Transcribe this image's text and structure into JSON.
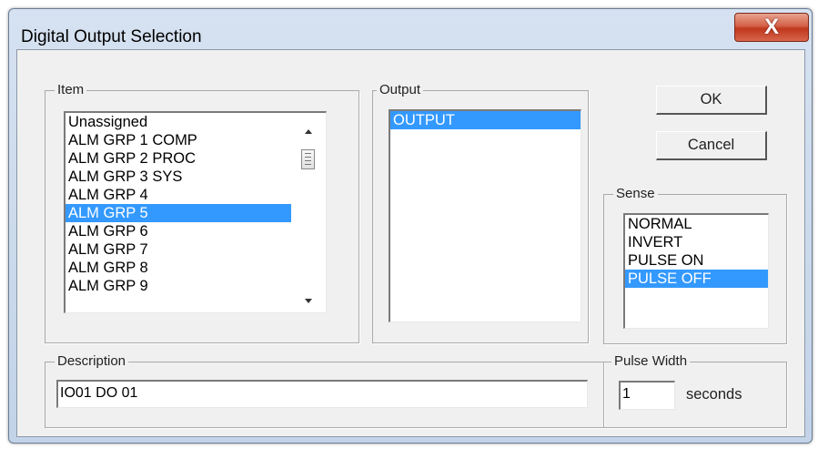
{
  "window": {
    "title": "Digital Output Selection",
    "close_glyph": "X"
  },
  "item_group": {
    "label": "Item",
    "items": [
      "Unassigned",
      "ALM GRP 1 COMP",
      "ALM GRP 2 PROC",
      "ALM GRP 3 SYS",
      "ALM GRP 4",
      "ALM GRP 5",
      "ALM GRP 6",
      "ALM GRP 7",
      "ALM GRP 8",
      "ALM GRP 9"
    ],
    "selected_index": 5
  },
  "output_group": {
    "label": "Output",
    "items": [
      "OUTPUT"
    ],
    "selected_index": 0
  },
  "buttons": {
    "ok": "OK",
    "cancel": "Cancel"
  },
  "sense_group": {
    "label": "Sense",
    "items": [
      "NORMAL",
      "INVERT",
      "PULSE ON",
      "PULSE OFF"
    ],
    "selected_index": 3
  },
  "description_group": {
    "label": "Description",
    "value": "IO01 DO 01"
  },
  "pulse_group": {
    "label": "Pulse Width",
    "value": "1",
    "unit": "seconds"
  },
  "colors": {
    "selection": "#3399ff",
    "close_button": "#c9472c"
  }
}
